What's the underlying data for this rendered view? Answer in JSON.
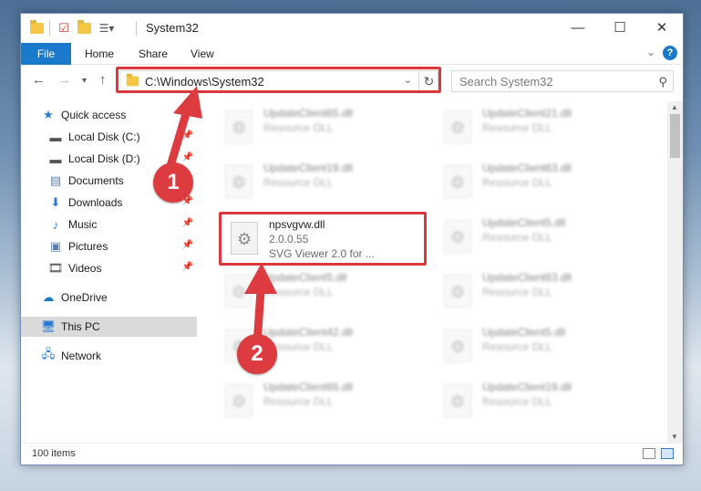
{
  "window": {
    "title": "System32",
    "controls": {
      "minimize": "—",
      "maximize": "☐",
      "close": "✕"
    }
  },
  "ribbon": {
    "tabs": [
      "File",
      "Home",
      "Share",
      "View"
    ],
    "help": "?"
  },
  "address_bar": {
    "path": "C:\\Windows\\System32",
    "search_placeholder": "Search System32"
  },
  "sidebar": {
    "items": [
      {
        "label": "Quick access",
        "icon": "star-icon",
        "pinned": false
      },
      {
        "label": "Local Disk (C:)",
        "icon": "drive-icon",
        "pinned": true
      },
      {
        "label": "Local Disk (D:)",
        "icon": "drive-icon",
        "pinned": true
      },
      {
        "label": "Documents",
        "icon": "documents-icon",
        "pinned": true
      },
      {
        "label": "Downloads",
        "icon": "download-icon",
        "pinned": true
      },
      {
        "label": "Music",
        "icon": "music-icon",
        "pinned": true
      },
      {
        "label": "Pictures",
        "icon": "pictures-icon",
        "pinned": true
      },
      {
        "label": "Videos",
        "icon": "video-icon",
        "pinned": true
      },
      {
        "label": "OneDrive",
        "icon": "cloud-icon",
        "pinned": false
      },
      {
        "label": "This PC",
        "icon": "computer-icon",
        "pinned": false,
        "selected": true
      },
      {
        "label": "Network",
        "icon": "network-icon",
        "pinned": false
      }
    ]
  },
  "files": {
    "left": [
      {
        "name": "UpdateClient65.dll",
        "desc": "Resource DLL",
        "blurred": true
      },
      {
        "name": "UpdateClient19.dll",
        "desc": "Resource DLL",
        "blurred": true
      },
      {
        "name": "npsvgvw.dll",
        "version": "2.0.0.55",
        "desc": "SVG Viewer 2.0 for ...",
        "blurred": false
      },
      {
        "name": "UpdateClient5.dll",
        "desc": "Resource DLL",
        "blurred": true
      },
      {
        "name": "UpdateClient42.dll",
        "desc": "Resource DLL",
        "blurred": true
      },
      {
        "name": "UpdateClient65.dll",
        "desc": "Resource DLL",
        "blurred": true
      }
    ],
    "right": [
      {
        "name": "UpdateClient21.dll",
        "desc": "Resource DLL",
        "blurred": true
      },
      {
        "name": "UpdateClient63.dll",
        "desc": "Resource DLL",
        "blurred": true
      },
      {
        "name": "UpdateClient5.dll",
        "desc": "Resource DLL",
        "blurred": true
      },
      {
        "name": "UpdateClient63.dll",
        "desc": "Resource DLL",
        "blurred": true
      },
      {
        "name": "UpdateClient5.dll",
        "desc": "Resource DLL",
        "blurred": true
      },
      {
        "name": "UpdateClient19.dll",
        "desc": "Resource DLL",
        "blurred": true
      }
    ]
  },
  "status": {
    "item_count": "100 items"
  },
  "annotations": {
    "step1": "1",
    "step2": "2",
    "color": "#dc3b3f"
  }
}
